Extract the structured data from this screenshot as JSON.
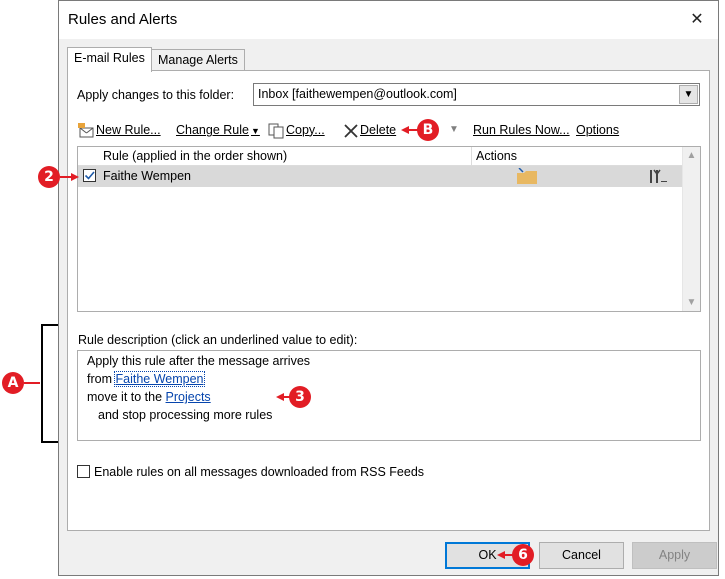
{
  "dialog": {
    "title": "Rules and Alerts",
    "close_symbol": "✕"
  },
  "tabs": [
    {
      "label": "E-mail Rules",
      "active": true
    },
    {
      "label": "Manage Alerts",
      "active": false
    }
  ],
  "folder": {
    "label": "Apply changes to this folder:",
    "value": "Inbox [faithewempen@outlook.com]"
  },
  "toolbar": {
    "new_rule": "New Rule...",
    "change_rule": "Change Rule",
    "copy": "Copy...",
    "delete": "Delete",
    "run_rules": "Run Rules Now...",
    "options": "Options"
  },
  "rules_list": {
    "headers": {
      "rule": "Rule (applied in the order shown)",
      "actions": "Actions"
    },
    "rows": [
      {
        "name": "Faithe Wempen",
        "checked": true
      }
    ]
  },
  "description": {
    "label": "Rule description (click an underlined value to edit):",
    "line1": "Apply this rule after the message arrives",
    "from_prefix": "from",
    "from_link": "Faithe Wempen",
    "move_prefix": "move it to the",
    "move_link": "Projects",
    "line4": "and stop processing more rules"
  },
  "rss": {
    "label": "Enable rules on all messages downloaded from RSS Feeds",
    "checked": false
  },
  "buttons": {
    "ok": "OK",
    "cancel": "Cancel",
    "apply": "Apply"
  },
  "callouts": {
    "a": "A",
    "b": "B",
    "two": "2",
    "three": "3",
    "six": "6"
  },
  "colors": {
    "callout": "#e21d25",
    "link": "#0645ad",
    "primary_border": "#0078d7"
  }
}
